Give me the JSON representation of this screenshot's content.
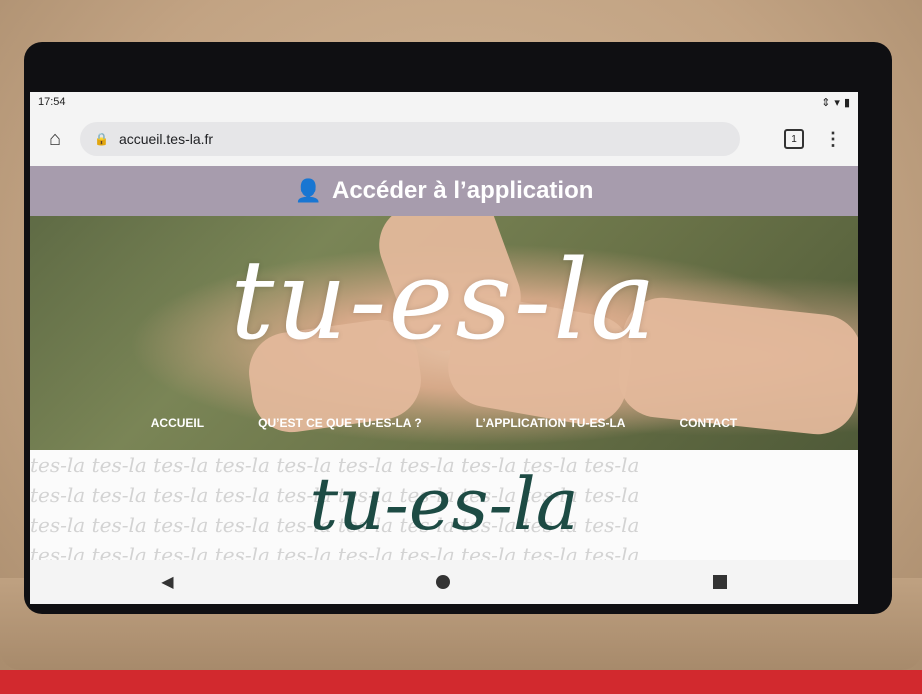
{
  "status_bar": {
    "time": "17:54",
    "icons": [
      "vibrate-icon",
      "wifi-icon",
      "battery-icon"
    ]
  },
  "browser": {
    "url": "accueil.tes-la.fr",
    "tab_count": "1"
  },
  "banner": {
    "label": "Accéder à l’application"
  },
  "hero": {
    "logo_text": "tu-es-la",
    "nav": [
      "ACCUEIL",
      "QU’EST CE QUE TU-ES-LA ?",
      "L’APPLICATION TU-ES-LA",
      "CONTACT"
    ]
  },
  "section": {
    "logo_text": "tu-es-la",
    "pattern_text": "tes-la"
  },
  "colors": {
    "banner": "#a79cad",
    "logo_dark": "#1d4b44",
    "case": "#c2a383",
    "case_base": "#d2292e"
  }
}
